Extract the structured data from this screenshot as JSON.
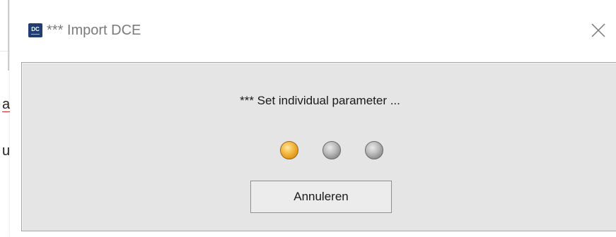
{
  "window": {
    "title": "*** Import DCE",
    "icon": "dc-app-icon",
    "icon_text": "DC"
  },
  "dialog": {
    "message": "*** Set individual parameter ...",
    "progress": {
      "total_steps": 3,
      "active_step": 1
    },
    "cancel_label": "Annuleren"
  },
  "background_app": {
    "fragment_1": "a",
    "fragment_2": "u"
  },
  "colors": {
    "active_dot": "#f2b33d",
    "inactive_dot": "#9a9a9a",
    "content_bg": "#e5e5e5",
    "title_text": "#7a7a7a"
  }
}
